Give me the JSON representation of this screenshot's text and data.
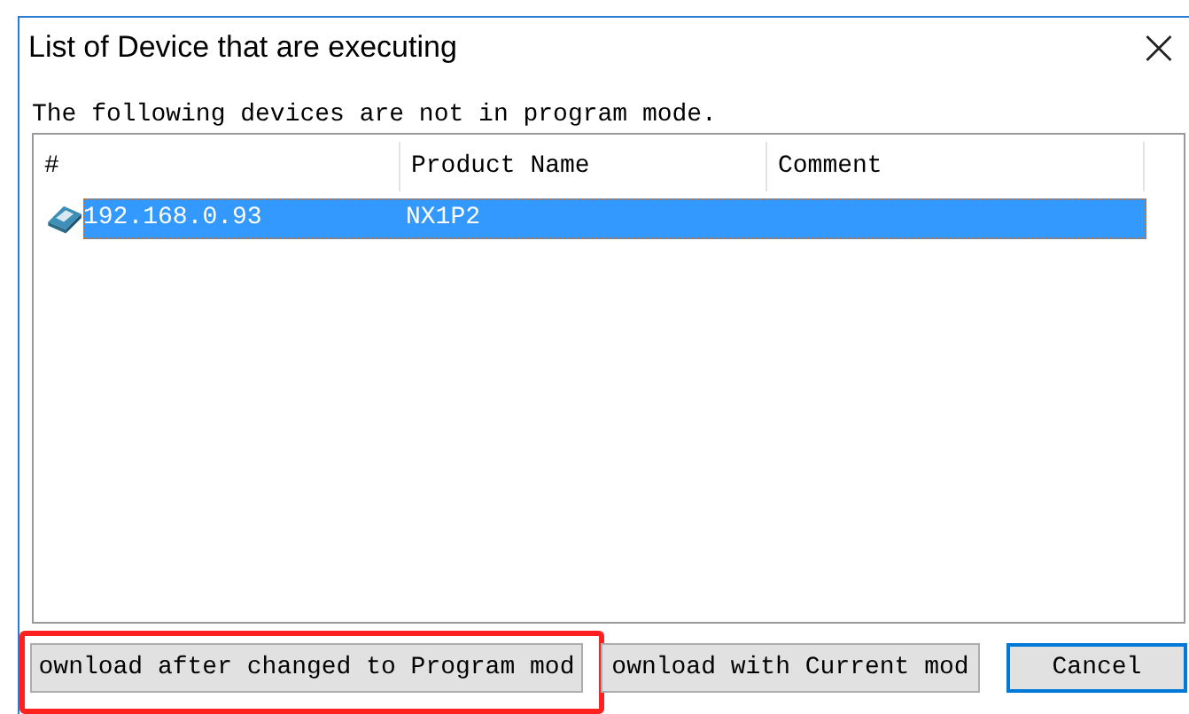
{
  "window": {
    "title": "List of Device that are executing",
    "close": "×"
  },
  "message": "The following devices are not in program mode.",
  "table": {
    "columns": [
      "#",
      "Product Name",
      "Comment"
    ],
    "rows": [
      {
        "address": "192.168.0.93",
        "product_name": "NX1P2",
        "comment": "",
        "selected": true
      }
    ]
  },
  "buttons": [
    {
      "label": "ownload after changed to Program mod",
      "default": false,
      "highlighted": true
    },
    {
      "label": "ownload with Current mod",
      "default": false,
      "highlighted": false
    },
    {
      "label": "Cancel",
      "default": true,
      "highlighted": false
    }
  ]
}
